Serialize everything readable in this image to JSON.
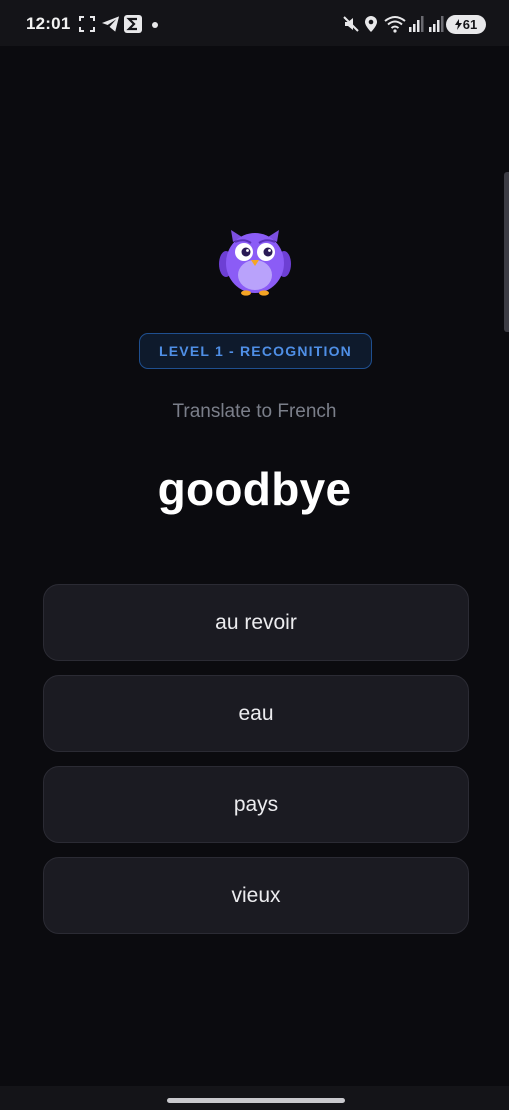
{
  "status_bar": {
    "time": "12:01",
    "battery": "61",
    "icons": [
      "screenshot-icon",
      "telegram-icon",
      "sigma-app-icon",
      "notification-dot-icon",
      "mute-icon",
      "location-icon",
      "wifi-icon",
      "signal-icon",
      "signal-icon",
      "battery-icon"
    ]
  },
  "lesson": {
    "mascot": "owl-mascot-icon",
    "level_badge": "LEVEL 1 - RECOGNITION",
    "instruction": "Translate to French",
    "word": "goodbye",
    "options": [
      {
        "label": "au revoir"
      },
      {
        "label": "eau"
      },
      {
        "label": "pays"
      },
      {
        "label": "vieux"
      }
    ]
  },
  "colors": {
    "background": "#0b0b0f",
    "badge_text": "#4f8fe6",
    "badge_border": "#1f4f8f",
    "option_bg": "#1b1b22",
    "mascot_purple": "#8b5cf6"
  }
}
